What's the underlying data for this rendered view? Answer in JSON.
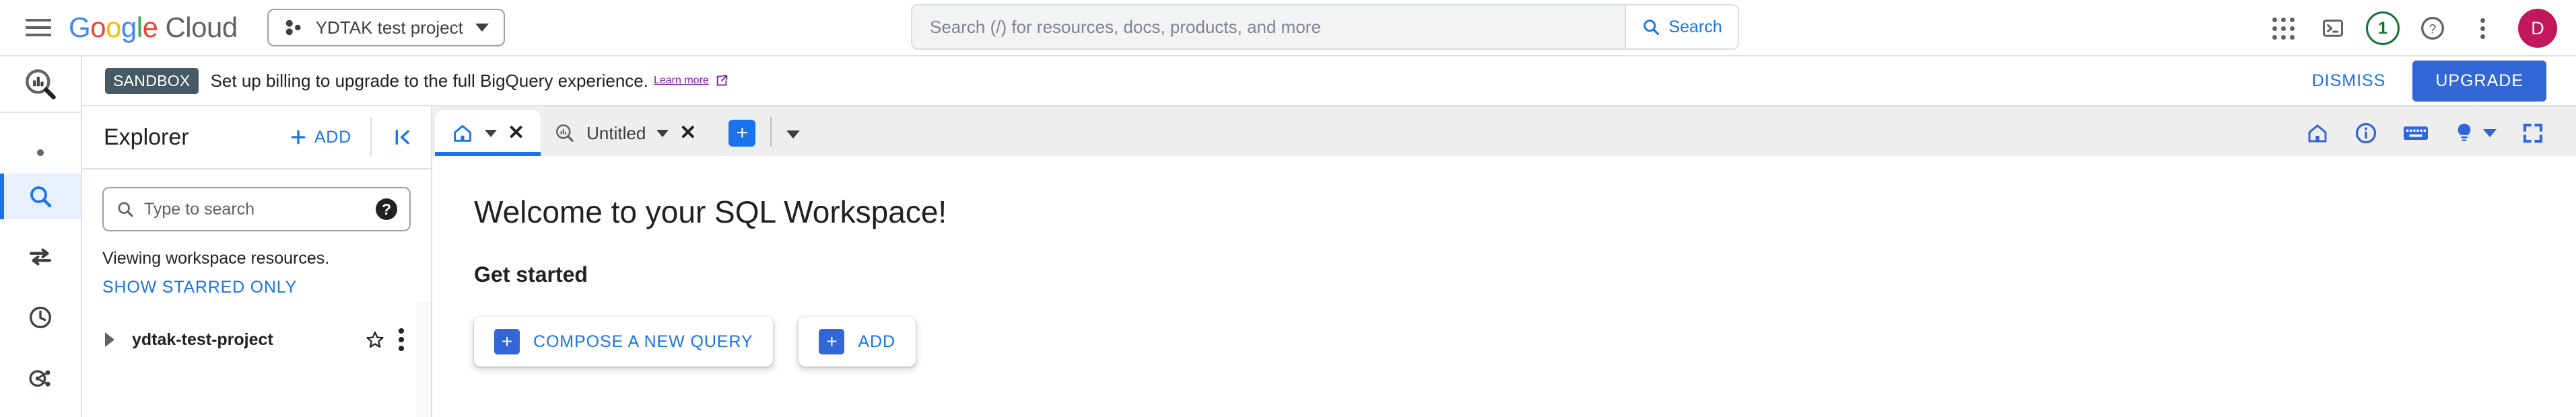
{
  "topbar": {
    "menu_icon": "hamburger-icon",
    "logo": {
      "google": "Google",
      "cloud": "Cloud"
    },
    "project_selector": {
      "label": "YDTAK test project",
      "icon": "project-dots-icon"
    },
    "search": {
      "placeholder": "Search (/) for resources, docs, products, and more",
      "value": "",
      "button_label": "Search",
      "button_icon": "search-icon"
    },
    "icons": {
      "apps": "apps-grid-icon",
      "cloud_shell": "cloud-shell-terminal-icon",
      "notifications_count": "1",
      "help": "help-circle-icon",
      "more": "more-vert-icon"
    },
    "avatar_initial": "D"
  },
  "notification": {
    "badge": "SANDBOX",
    "message": "Set up billing to upgrade to the full BigQuery experience.",
    "link_text": "Learn more",
    "link_icon": "open-in-new-icon",
    "dismiss_label": "DISMISS",
    "upgrade_label": "UPGRADE"
  },
  "rail": {
    "product_icon": "bigquery-magnifier-icon",
    "items": [
      {
        "name": "dot-item",
        "icon": "dot-icon",
        "active": false
      },
      {
        "name": "search",
        "icon": "search-icon",
        "active": true
      },
      {
        "name": "data-transfers",
        "icon": "transfer-arrows-icon",
        "active": false
      },
      {
        "name": "scheduled-queries",
        "icon": "clock-icon",
        "active": false
      },
      {
        "name": "analytics-hub",
        "icon": "analytics-hub-icon",
        "active": false
      }
    ]
  },
  "explorer": {
    "title": "Explorer",
    "add_label": "ADD",
    "add_icon": "plus-icon",
    "collapse_icon": "collapse-left-icon",
    "search_placeholder": "Type to search",
    "search_value": "",
    "search_icon": "search-icon",
    "help_icon": "help-icon",
    "viewing_text": "Viewing workspace resources.",
    "starred_link": "SHOW STARRED ONLY",
    "tree": [
      {
        "label": "ydtak-test-project",
        "expanded": false,
        "star_icon": "star-outline-icon",
        "menu_icon": "more-vert-icon"
      }
    ]
  },
  "workspace": {
    "tabs": [
      {
        "name": "home-tab",
        "label": "",
        "icon": "home-icon",
        "active": true,
        "closable": true,
        "has_caret": true
      },
      {
        "name": "untitled-query-tab",
        "label": "Untitled",
        "icon": "bigquery-magnifier-icon",
        "active": false,
        "closable": true,
        "has_caret": true
      }
    ],
    "new_tab_icon": "plus-icon",
    "new_tab_caret": "chevron-down-icon",
    "toolbar_icons": [
      "home-icon",
      "info-icon",
      "keyboard-icon",
      "lightbulb-icon",
      "fullscreen-icon"
    ],
    "content": {
      "heading": "Welcome to your SQL Workspace!",
      "subheading": "Get started",
      "actions": [
        {
          "label": "COMPOSE A NEW QUERY",
          "icon": "plus-square-icon"
        },
        {
          "label": "ADD",
          "icon": "plus-square-icon"
        }
      ]
    }
  },
  "colors": {
    "accent_blue": "#1a73e8",
    "button_blue": "#3367d6",
    "active_bg": "#e8f0fe",
    "sandbox_badge": "#455a64",
    "link_purple": "#7b1fa2",
    "notif_green": "#137333",
    "avatar_pink": "#c2185b",
    "tabbar_bg": "#eeeeee"
  }
}
